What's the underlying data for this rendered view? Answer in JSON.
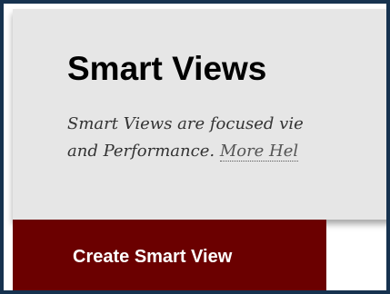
{
  "panel": {
    "title": "Smart Views",
    "description_line1": "Smart Views are focused vie",
    "description_line2_text": "and Performance. ",
    "more_help_link": "More Hel"
  },
  "actions": {
    "create_smart_view_label": "Create Smart View"
  }
}
